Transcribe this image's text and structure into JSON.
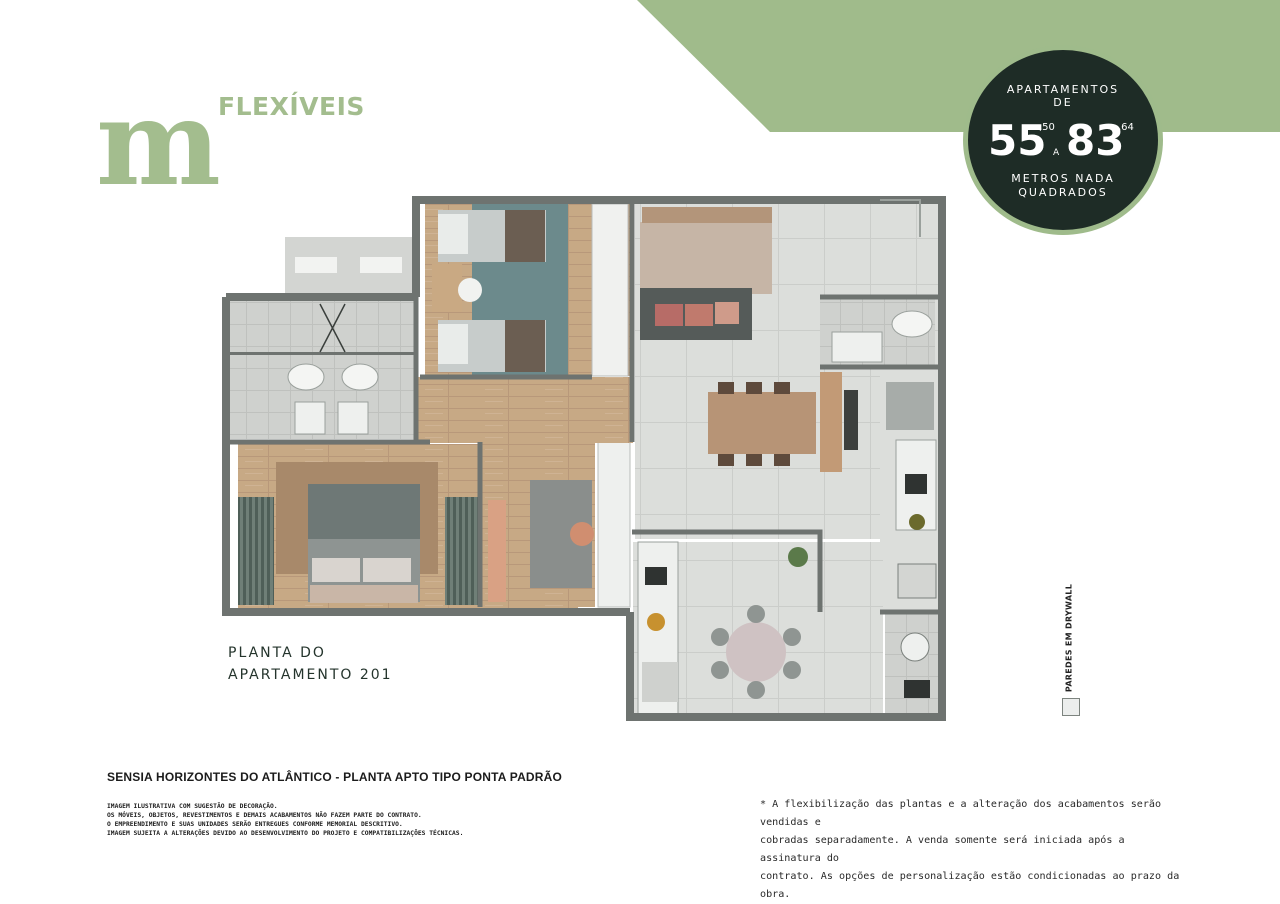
{
  "logo": {
    "letter": "m",
    "word": "FLEXÍVEIS"
  },
  "badge": {
    "top_line1": "APARTAMENTOS",
    "top_line2": "DE",
    "min_int": "55",
    "min_dec": ",50",
    "connector": "A",
    "max_int": "83",
    "max_dec": ",64",
    "bottom_line1": "METROS NADA",
    "bottom_line2": "QUADRADOS"
  },
  "plan": {
    "caption_line1": "PLANTA DO",
    "caption_line2": "APARTAMENTO 201"
  },
  "legend": {
    "drywall_label": "PAREDES EM DRYWALL"
  },
  "footer": {
    "title": "SENSIA HORIZONTES DO ATLÂNTICO - PLANTA APTO TIPO PONTA PADRÃO",
    "notes": [
      "IMAGEM ILUSTRATIVA COM SUGESTÃO DE DECORAÇÃO.",
      "OS MÓVEIS, OBJETOS, REVESTIMENTOS E DEMAIS ACABAMENTOS NÃO FAZEM PARTE DO CONTRATO.",
      "O EMPREENDIMENTO E SUAS UNIDADES SERÃO ENTREGUES CONFORME MEMORIAL DESCRITIVO.",
      "IMAGEM SUJEITA A ALTERAÇÕES DEVIDO AO DESENVOLVIMENTO DO PROJETO E COMPATIBILIZAÇÕES TÉCNICAS."
    ],
    "disclaimer_lines": [
      "* A flexibilização das plantas e a alteração dos acabamentos serão vendidas e",
      "cobradas separadamente. A venda somente será iniciada após a assinatura do",
      "contrato. As opções de personalização estão condicionadas ao prazo da obra."
    ]
  },
  "colors": {
    "brand_green": "#a3bd8e",
    "band_green": "#a0bb8b",
    "badge_dark": "#1e2c26",
    "wall_gray": "#6e7370"
  }
}
